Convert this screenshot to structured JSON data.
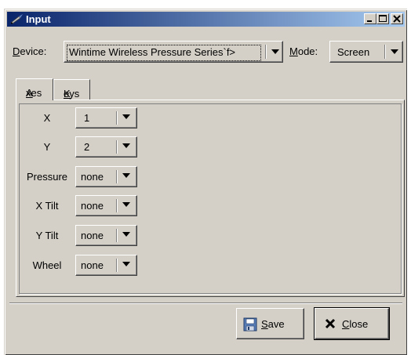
{
  "window": {
    "title": "Input"
  },
  "device": {
    "label_prefix": "",
    "label_mnemonic": "D",
    "label_rest": "evice:",
    "value": "Wintime Wireless Pressure Series`f>"
  },
  "mode": {
    "label_mnemonic": "M",
    "label_rest": "ode:",
    "value": "Screen"
  },
  "tabs": [
    {
      "mnemonic": "A",
      "rest": "xes"
    },
    {
      "mnemonic": "K",
      "rest": "eys"
    }
  ],
  "axes": [
    {
      "label": "X",
      "value": "1"
    },
    {
      "label": "Y",
      "value": "2"
    },
    {
      "label": "Pressure",
      "value": "none"
    },
    {
      "label": "X Tilt",
      "value": "none"
    },
    {
      "label": "Y Tilt",
      "value": "none"
    },
    {
      "label": "Wheel",
      "value": "none"
    }
  ],
  "buttons": {
    "save_mnemonic": "S",
    "save_rest": "ave",
    "close_mnemonic": "C",
    "close_rest": "lose"
  },
  "icons": {
    "app": "pen-tablet-icon",
    "save": "floppy-disk-icon",
    "close": "x-mark-icon",
    "dropdown": "triangle-down-icon"
  }
}
